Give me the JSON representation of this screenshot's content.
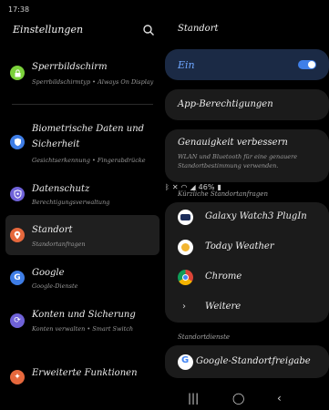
{
  "status_bar": {
    "time": "17:38",
    "battery": "46%",
    "icons": [
      "bluetooth-icon",
      "mute-icon",
      "wifi-icon",
      "signal-icon",
      "battery-icon"
    ]
  },
  "left_panel": {
    "title": "Einstellungen",
    "items": [
      {
        "icon": "lock-screen-icon",
        "color": "#7bd13b",
        "title": "Sperrbildschirm",
        "subtitle": "Sperrbildschirmtyp  •  Always On Display"
      },
      {
        "icon": "shield-icon",
        "color": "#3e7de6",
        "title": "Biometrische Daten und Sicherheit",
        "subtitle": "Gesichtserkennung  •  Fingerabdrücke"
      },
      {
        "icon": "privacy-icon",
        "color": "#6f62d8",
        "title": "Datenschutz",
        "subtitle": "Berechtigungsverwaltung"
      },
      {
        "icon": "location-icon",
        "color": "#e6683d",
        "title": "Standort",
        "subtitle": "Standortanfragen"
      },
      {
        "icon": "google-icon",
        "color": "#3e7de6",
        "title": "Google",
        "subtitle": "Google-Dienste"
      },
      {
        "icon": "accounts-sync-icon",
        "color": "#6f62d8",
        "title": "Konten und Sicherung",
        "subtitle": "Konten verwalten  •  Smart Switch"
      },
      {
        "icon": "advanced-features-icon",
        "color": "#e6683d",
        "title": "Erweiterte Funktionen",
        "subtitle": ""
      }
    ]
  },
  "right_panel": {
    "title": "Standort",
    "toggle": {
      "label": "Ein",
      "on": true
    },
    "app_permissions": "App-Berechtigungen",
    "accuracy": {
      "title": "Genauigkeit verbessern",
      "subtitle_line1": "WLAN und Bluetooth für eine genauere",
      "subtitle_line2": "Standortbestimmung verwenden."
    },
    "recent_header": "Kürzliche Standortanfragen",
    "recent_apps": [
      "Galaxy Watch3 PlugIn",
      "Today Weather",
      "Chrome"
    ],
    "more": "Weitere",
    "services_header": "Standortdienste",
    "services": [
      "Google-Standortfreigabe"
    ]
  }
}
